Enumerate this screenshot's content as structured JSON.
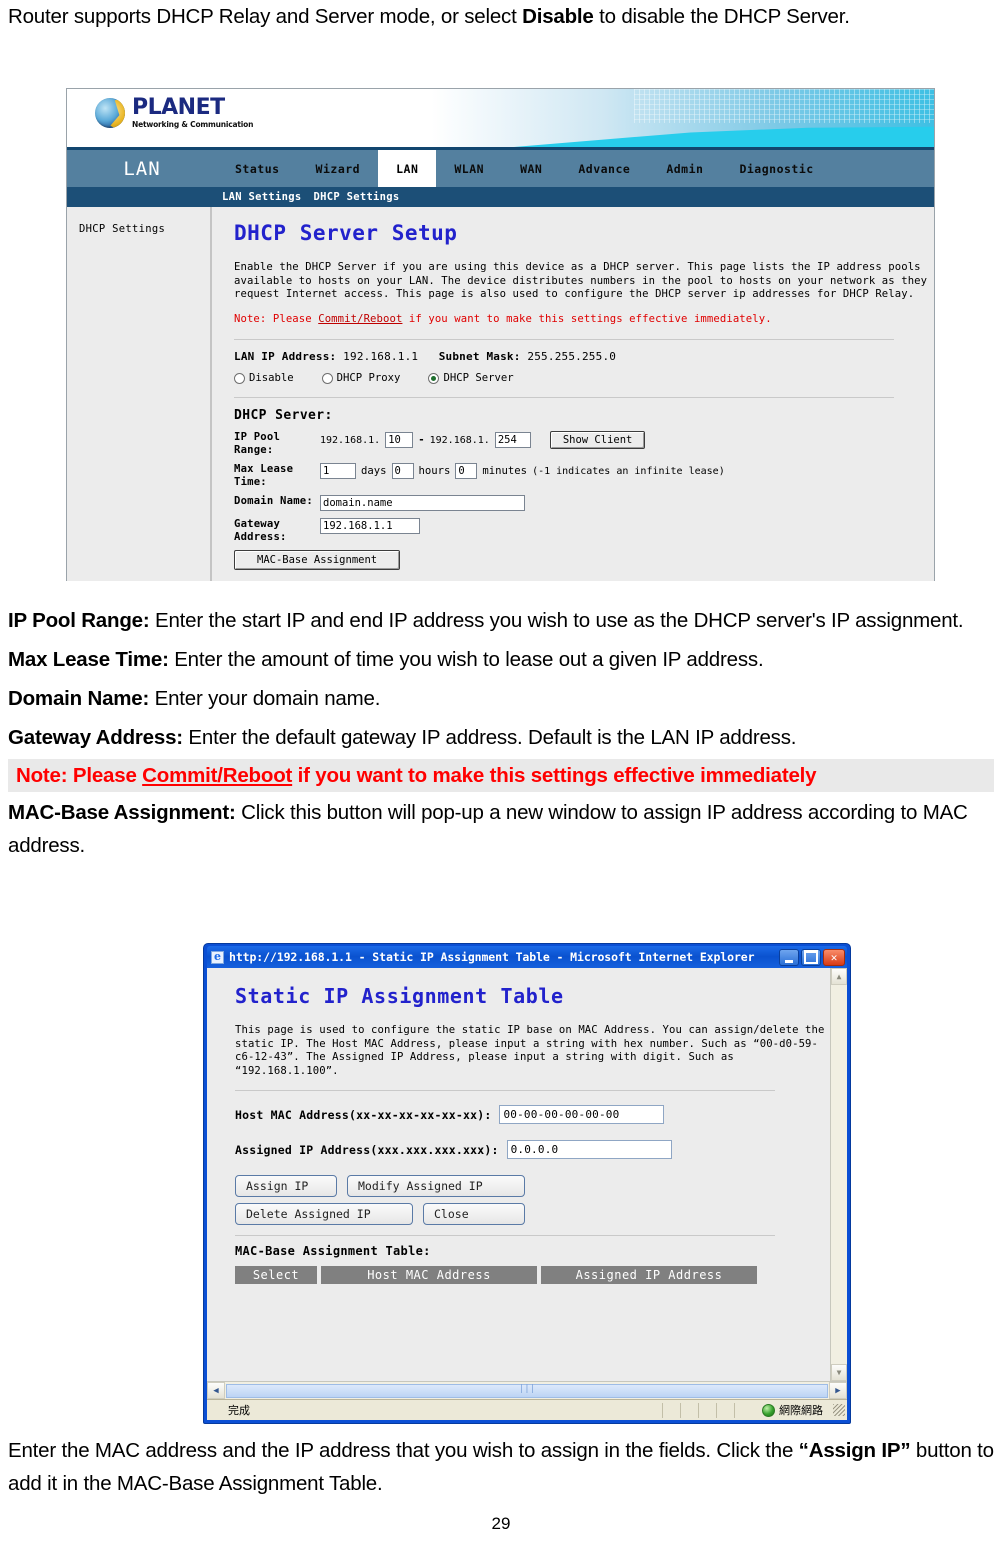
{
  "document": {
    "intro": {
      "before_bold": "Router supports DHCP Relay and Server mode, or select ",
      "bold": "Disable",
      "after_bold": " to disable the DHCP Server."
    },
    "definitions": [
      {
        "term": "IP Pool Range:",
        "text": " Enter the start IP and end IP address you wish to use as the DHCP server's IP assignment."
      },
      {
        "term": "Max Lease Time:",
        "text": " Enter the amount of time you wish to lease out a given IP address."
      },
      {
        "term": "Domain Name:",
        "text": " Enter your domain name."
      },
      {
        "term": "Gateway Address:",
        "text": " Enter the default gateway IP address. Default is the LAN IP address."
      }
    ],
    "note": {
      "prefix": "Note: Please ",
      "link": "Commit/Reboot",
      "suffix": " if you want to make this settings effective immediately"
    },
    "mac_base": {
      "term": "MAC-Base Assignment:",
      "text": " Click this button will pop-up a new window to assign IP address according to MAC address."
    },
    "closing": {
      "before_bold": "Enter the MAC address and the IP address that you wish to assign in the fields. Click the ",
      "bold": "“Assign IP”",
      "after_bold": " button to add it in the MAC-Base Assignment Table."
    },
    "page_number": "29"
  },
  "router_ui": {
    "brand": {
      "name": "PLANET",
      "tagline": "Networking & Communication"
    },
    "nav_brand_label": "LAN",
    "nav_items": [
      {
        "label": "Status",
        "active": false
      },
      {
        "label": "Wizard",
        "active": false
      },
      {
        "label": "LAN",
        "active": true
      },
      {
        "label": "WLAN",
        "active": false
      },
      {
        "label": "WAN",
        "active": false
      },
      {
        "label": "Advance",
        "active": false
      },
      {
        "label": "Admin",
        "active": false
      },
      {
        "label": "Diagnostic",
        "active": false
      }
    ],
    "subnav_items": [
      "LAN Settings",
      "DHCP Settings"
    ],
    "sidebar_items": [
      "DHCP Settings"
    ],
    "panel_title": "DHCP Server Setup",
    "description": "Enable the DHCP Server if you are using this device as a DHCP server. This page lists the IP address pools available to hosts on your LAN. The device distributes numbers in the pool to hosts on your network as they request Internet access. This page is also used to configure the DHCP server ip addresses for DHCP Relay.",
    "note_prefix": "Note: Please ",
    "note_link": "Commit/Reboot",
    "note_suffix": " if you want to make this settings effective immediately.",
    "lan_ip_label": "LAN IP Address:",
    "lan_ip_value": "192.168.1.1",
    "subnet_label": "Subnet Mask:",
    "subnet_value": "255.255.255.0",
    "modes": [
      {
        "label": "Disable",
        "selected": false
      },
      {
        "label": "DHCP Proxy",
        "selected": false
      },
      {
        "label": "DHCP Server",
        "selected": true
      }
    ],
    "section_title": "DHCP Server:",
    "fields": {
      "pool_label": "IP Pool Range:",
      "pool_prefix_start": "192.168.1.",
      "pool_start": "10",
      "pool_sep": "-",
      "pool_prefix_end": "192.168.1.",
      "pool_end": "254",
      "show_client_button": "Show Client",
      "lease_label": "Max Lease Time:",
      "lease_days": "1",
      "lease_days_unit": "days",
      "lease_hours": "0",
      "lease_hours_unit": "hours",
      "lease_minutes": "0",
      "lease_minutes_unit": "minutes",
      "lease_hint": "(-1 indicates an infinite lease)",
      "domain_label": "Domain Name:",
      "domain_value": "domain.name",
      "gateway_label": "Gateway Address:",
      "gateway_value": "192.168.1.1",
      "mac_base_button": "MAC-Base Assignment"
    }
  },
  "ie_window": {
    "title": "http://192.168.1.1 - Static IP Assignment Table - Microsoft Internet Explorer",
    "page_title": "Static IP Assignment Table",
    "page_desc": "This page is used to configure the static IP base on MAC Address. You can assign/delete the static IP. The Host MAC Address, please input a string with hex number. Such as “00-d0-59-c6-12-43”. The Assigned IP Address, please input a string with digit. Such as “192.168.1.100”.",
    "mac_label": "Host MAC Address(xx-xx-xx-xx-xx-xx):",
    "mac_value": "00-00-00-00-00-00",
    "ip_label": "Assigned IP Address(xxx.xxx.xxx.xxx):",
    "ip_value": "0.0.0.0",
    "buttons": {
      "assign": "Assign IP",
      "modify": "Modify Assigned IP",
      "delete": "Delete Assigned IP",
      "close": "Close"
    },
    "table_label": "MAC-Base Assignment Table:",
    "table_headers": [
      "Select",
      "Host MAC Address",
      "Assigned IP Address"
    ],
    "table_rows": [],
    "status_left": "完成",
    "status_right": "網際網路"
  },
  "colors": {
    "link_red": "#ff0000",
    "panel_title_blue": "#2222cc",
    "nav_bar": "#54809f",
    "subnav_bar": "#1c4f77",
    "ie_title_blue": "#0b4fd4",
    "table_header_gray": "#808080"
  }
}
